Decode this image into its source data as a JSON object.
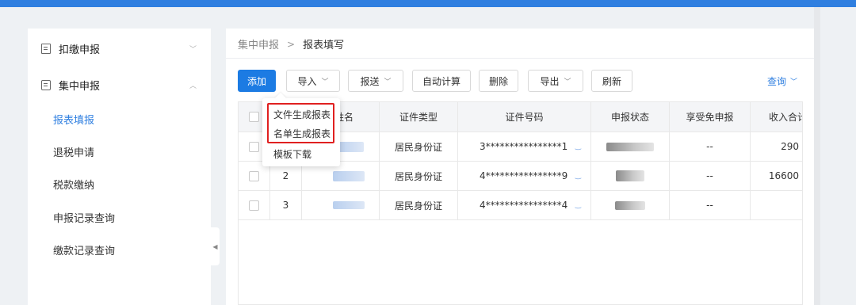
{
  "sidebar": {
    "groups": [
      {
        "label": "扣缴申报",
        "icon": "form-icon",
        "expanded": false
      },
      {
        "label": "集中申报",
        "icon": "monitor-form-icon",
        "expanded": true
      }
    ],
    "sub_items": [
      {
        "label": "报表填报",
        "active": true
      },
      {
        "label": "退税申请",
        "active": false
      },
      {
        "label": "税款缴纳",
        "active": false
      },
      {
        "label": "申报记录查询",
        "active": false
      },
      {
        "label": "缴款记录查询",
        "active": false
      }
    ]
  },
  "breadcrumb": {
    "parent": "集中申报",
    "separator": ">",
    "current": "报表填写"
  },
  "toolbar": {
    "add": "添加",
    "import": "导入",
    "send": "报送",
    "auto_calc": "自动计算",
    "delete": "删除",
    "export": "导出",
    "refresh": "刷新",
    "query": "查询"
  },
  "import_menu": {
    "items": [
      "文件生成报表",
      "名单生成报表",
      "模板下载"
    ]
  },
  "table": {
    "columns": [
      "",
      "",
      "姓名",
      "证件类型",
      "证件号码",
      "申报状态",
      "享受免申报",
      "收入合计"
    ],
    "rows": [
      {
        "index": "",
        "id_type": "居民身份证",
        "id_number": "3****************1",
        "exempt": "--",
        "income": "290"
      },
      {
        "index": "2",
        "id_type": "居民身份证",
        "id_number": "4****************9",
        "exempt": "--",
        "income": "16600"
      },
      {
        "index": "3",
        "id_type": "居民身份证",
        "id_number": "4****************4",
        "exempt": "--",
        "income": ""
      }
    ]
  },
  "colors": {
    "accent": "#1c7be3",
    "highlight": "#e02020",
    "topbar": "#2f7fe0"
  }
}
